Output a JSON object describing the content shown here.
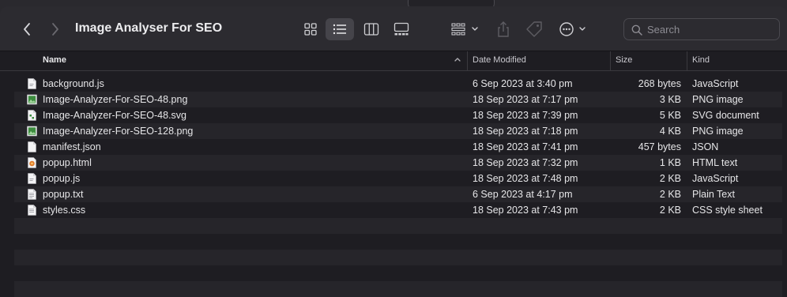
{
  "window": {
    "title": "Image Analyser For SEO"
  },
  "search": {
    "placeholder": "Search"
  },
  "columns": {
    "name": "Name",
    "date": "Date Modified",
    "size": "Size",
    "kind": "Kind"
  },
  "files": [
    {
      "name": "background.js",
      "date": "6 Sep 2023 at 3:40 pm",
      "size": "268 bytes",
      "kind": "JavaScript",
      "icon": "js-file-icon"
    },
    {
      "name": "Image-Analyzer-For-SEO-48.png",
      "date": "18 Sep 2023 at 7:17 pm",
      "size": "3 KB",
      "kind": "PNG image",
      "icon": "image-file-icon"
    },
    {
      "name": "Image-Analyzer-For-SEO-48.svg",
      "date": "18 Sep 2023 at 7:39 pm",
      "size": "5 KB",
      "kind": "SVG document",
      "icon": "svg-file-icon"
    },
    {
      "name": "Image-Analyzer-For-SEO-128.png",
      "date": "18 Sep 2023 at 7:18 pm",
      "size": "4 KB",
      "kind": "PNG image",
      "icon": "image-file-icon"
    },
    {
      "name": "manifest.json",
      "date": "18 Sep 2023 at 7:41 pm",
      "size": "457 bytes",
      "kind": "JSON",
      "icon": "json-file-icon"
    },
    {
      "name": "popup.html",
      "date": "18 Sep 2023 at 7:32 pm",
      "size": "1 KB",
      "kind": "HTML text",
      "icon": "html-file-icon"
    },
    {
      "name": "popup.js",
      "date": "18 Sep 2023 at 7:48 pm",
      "size": "2 KB",
      "kind": "JavaScript",
      "icon": "js-file-icon"
    },
    {
      "name": "popup.txt",
      "date": "6 Sep 2023 at 4:17 pm",
      "size": "2 KB",
      "kind": "Plain Text",
      "icon": "text-file-icon"
    },
    {
      "name": "styles.css",
      "date": "18 Sep 2023 at 7:43 pm",
      "size": "2 KB",
      "kind": "CSS style sheet",
      "icon": "css-file-icon"
    }
  ],
  "colors": {
    "window_bg": "#1e1d22",
    "toolbar_bg": "#2c2b30",
    "row_alt": "#26252a",
    "image_icon": "#3d8c3f"
  }
}
